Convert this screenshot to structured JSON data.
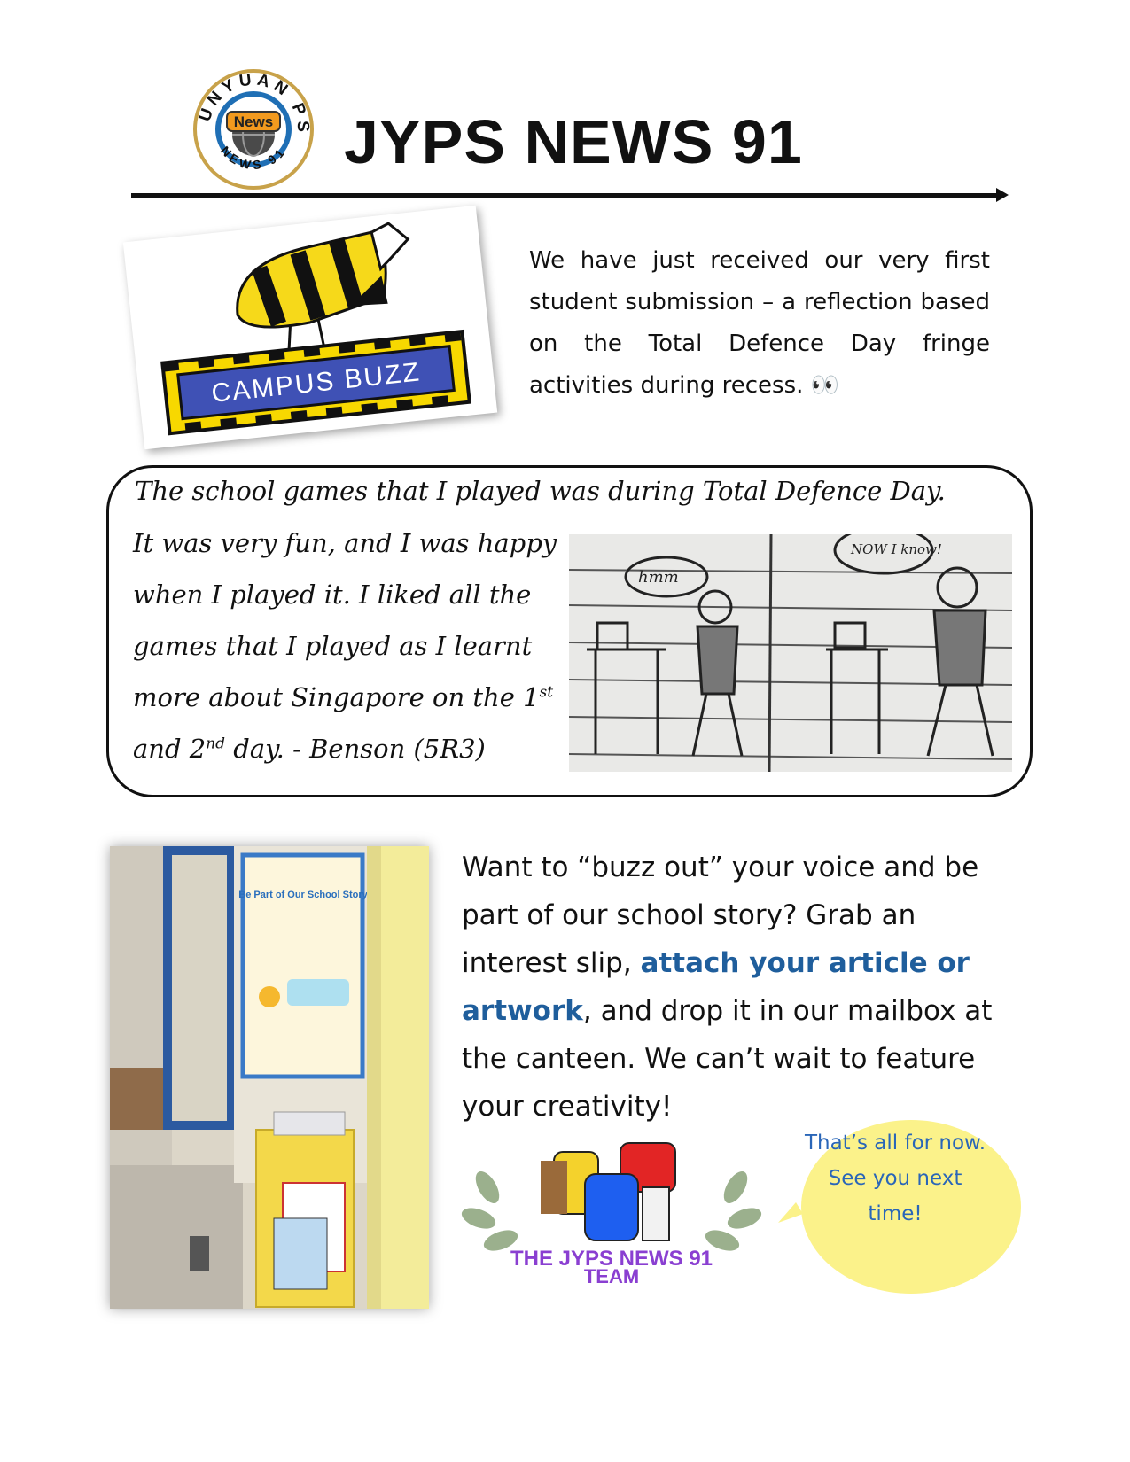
{
  "header": {
    "title": "JYPS NEWS 91",
    "logo": {
      "top_text": "JUNYUAN PS",
      "center_text": "News",
      "bottom_text": "NEWS 91"
    }
  },
  "campus_buzz": {
    "label": "CAMPUS BUZZ"
  },
  "intro": {
    "text": "We have just received our very first student submission – a reflection based on the Total Defence Day fringe activities during recess. 👀"
  },
  "reflection": {
    "line1": "The school games that I played was during Total Defence Day.",
    "line2": "It was very fun, and I was happy",
    "line3": "when I played it. I liked all the",
    "line4": "games that I played as I learnt",
    "line5_pre": "more about Singapore on the 1",
    "line5_sup": "st",
    "line6_pre": "and 2",
    "line6_sup": "nd",
    "line6_post": " day. - Benson (5R3)",
    "drawing": {
      "left_bubble": "hmm",
      "right_bubble": "NOW I know!"
    }
  },
  "photo": {
    "poster_title": "Be Part of Our School Story"
  },
  "cta": {
    "part1": "Want to “buzz out” your voice and be part of our school story? Grab an interest slip, ",
    "link": "attach your article or artwork",
    "part2": ", and drop it in our mailbox at the canteen. We can’t wait to feature your creativity!"
  },
  "team_logo": {
    "line1": "THE JYPS NEWS 91",
    "line2": "TEAM"
  },
  "bubble": {
    "text": "That’s all for now. See you next time!"
  },
  "colors": {
    "link": "#1f5e9c",
    "bubble_fill": "#fbf28a",
    "bubble_text": "#2a66b8",
    "buzz_blue": "#3f51b5",
    "buzz_yellow": "#f7d800",
    "team_purple": "#8a3fd1"
  }
}
